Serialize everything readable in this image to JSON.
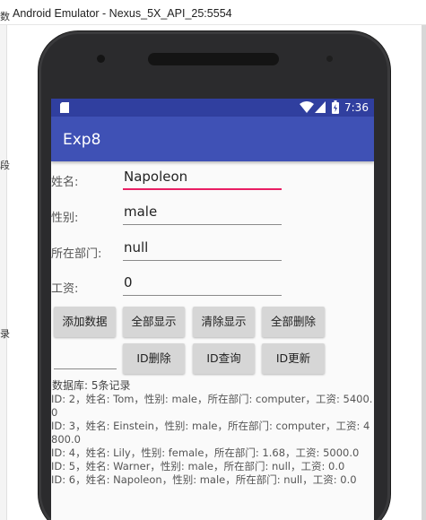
{
  "window": {
    "title": "Android Emulator - Nexus_5X_API_25:5554",
    "edge_chars": [
      "数",
      "段",
      "录"
    ]
  },
  "status_bar": {
    "time": "7:36",
    "icons": [
      "sd-card-icon",
      "wifi-icon",
      "signal-icon",
      "battery-icon"
    ],
    "color": "#303f9f"
  },
  "app_bar": {
    "title": "Exp8",
    "color": "#3f51b5"
  },
  "form": {
    "name": {
      "label": "姓名:",
      "value": "Napoleon"
    },
    "gender": {
      "label": "性别:",
      "value": "male"
    },
    "department": {
      "label": "所在部门:",
      "value": "null"
    },
    "salary": {
      "label": "工资:",
      "value": "0"
    },
    "focus_color": "#e91e63"
  },
  "buttons": {
    "add": "添加数据",
    "show_all": "全部显示",
    "clear_display": "清除显示",
    "delete_all": "全部删除",
    "delete_by_id": "ID删除",
    "query_by_id": "ID查询",
    "update_by_id": "ID更新"
  },
  "id_input": {
    "value": ""
  },
  "database": {
    "summary": "数据库: 5条记录",
    "records": [
      "ID: 2，姓名: Tom，性别: male，所在部门: computer，工资: 5400.0",
      "ID: 3，姓名: Einstein，性别: male，所在部门: computer，工资: 4800.0",
      "ID: 4，姓名: Lily，性别: female，所在部门: 1.68，工资: 5000.0",
      "ID: 5，姓名: Warner，性别: male，所在部门: null，工资: 0.0",
      "ID: 6，姓名: Napoleon，性别: male，所在部门: null，工资: 0.0"
    ]
  }
}
